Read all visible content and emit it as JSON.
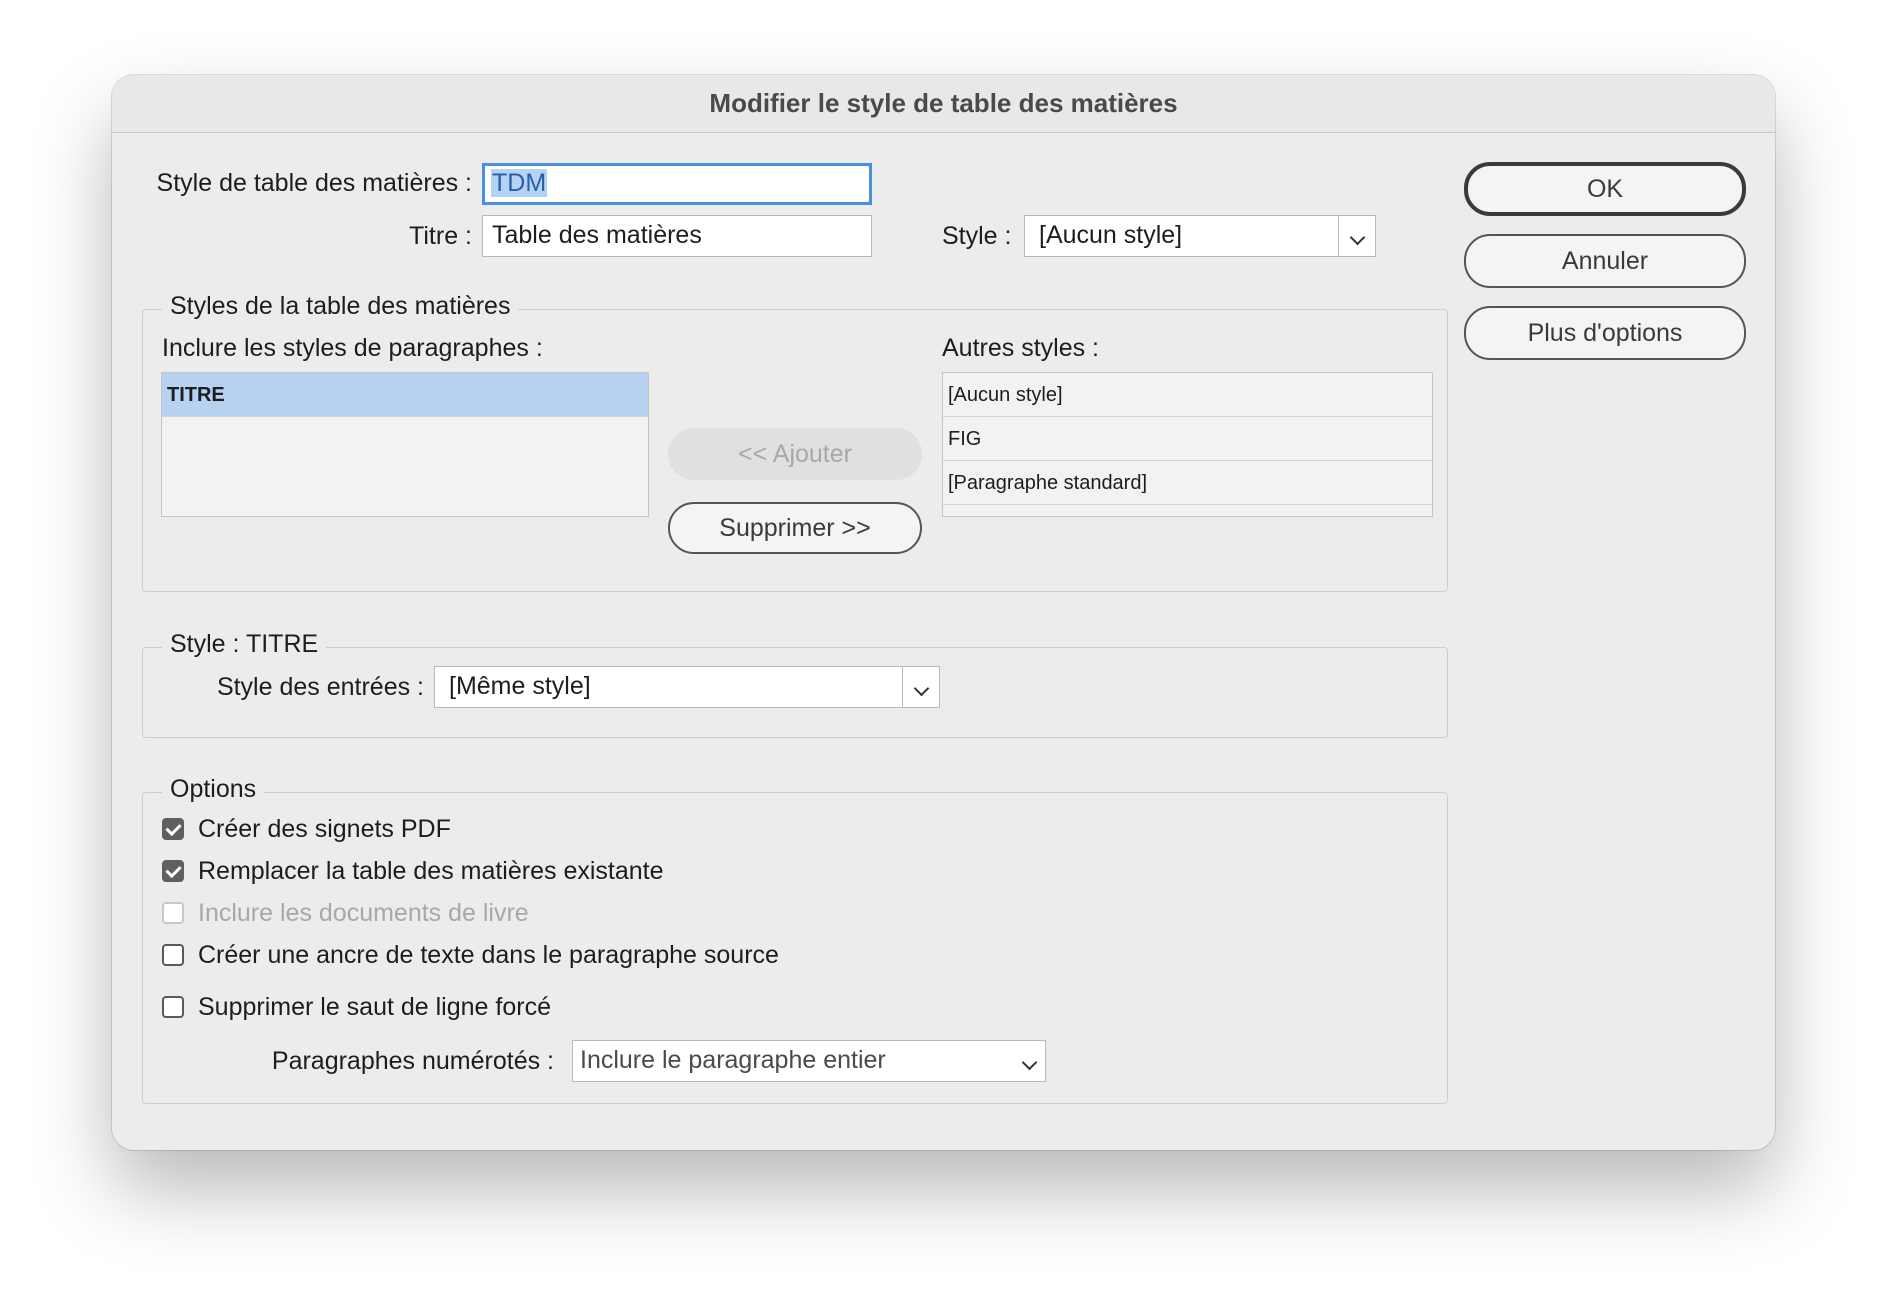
{
  "window": {
    "title": "Modifier le style de table des matières"
  },
  "toc": {
    "style_label": "Style de table des matières :",
    "style_value": "TDM",
    "title_label": "Titre :",
    "title_value": "Table des matières",
    "style_select_label": "Style :",
    "style_select_value": "[Aucun style]"
  },
  "buttons": {
    "ok": "OK",
    "cancel": "Annuler",
    "more": "Plus d'options",
    "add": "<< Ajouter",
    "remove": "Supprimer >>"
  },
  "styles_group": {
    "legend": "Styles de la table des matières",
    "include_label": "Inclure les styles de paragraphes :",
    "included": [
      "TITRE"
    ],
    "other_label": "Autres styles :",
    "others": [
      "[Aucun style]",
      "FIG",
      "[Paragraphe standard]"
    ]
  },
  "style_group": {
    "legend": "Style : TITRE",
    "entries_label": "Style des entrées :",
    "entries_value": "[Même style]"
  },
  "options": {
    "legend": "Options",
    "items": [
      {
        "label": "Créer des signets PDF",
        "checked": true,
        "disabled": false
      },
      {
        "label": "Remplacer la table des matières existante",
        "checked": true,
        "disabled": false
      },
      {
        "label": "Inclure les documents de livre",
        "checked": false,
        "disabled": true
      },
      {
        "label": "Créer une ancre de texte dans le paragraphe source",
        "checked": false,
        "disabled": false
      },
      {
        "label": "Supprimer le saut de ligne forcé",
        "checked": false,
        "disabled": false
      }
    ],
    "numbered_label": "Paragraphes numérotés :",
    "numbered_value": "Inclure le paragraphe entier"
  }
}
